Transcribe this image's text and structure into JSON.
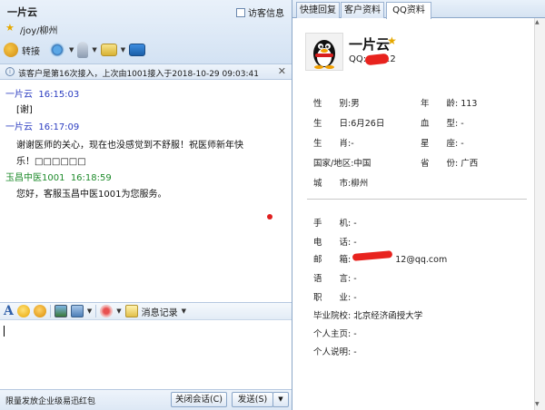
{
  "chat_window": {
    "contact_name": "一片云",
    "visitor_info_label": "访客信息",
    "location": "/joy/柳州",
    "toolbar": {
      "transfer_label": "转接"
    },
    "notice": "该客户是第16次接入，上次由1001接入于2018-10-29 09:03:41",
    "messages": [
      {
        "sender": "一片云",
        "time": "16:15:03",
        "text": "[谢]",
        "color": "#2b3cc0"
      },
      {
        "sender": "一片云",
        "time": "16:17:09",
        "text": "谢谢医师的关心，现在也没感觉到不舒服！祝医师新年快",
        "text2": "乐！□□□□□□",
        "color": "#2b3cc0"
      },
      {
        "sender": "玉昌中医1001",
        "time": "16:18:59",
        "text": "您好，客服玉昌中医1001为您服务。",
        "color": "#1e8b2b"
      }
    ],
    "input_toolbar": {
      "history_label": "消息记录"
    },
    "promo_link": "限量发放企业级易迅红包",
    "close_button": "关闭会话(C)",
    "send_button": "发送(S)"
  },
  "profile_panel": {
    "tabs": [
      {
        "label": "快捷回复",
        "active": false
      },
      {
        "label": "客户资料",
        "active": false
      },
      {
        "label": "QQ资料",
        "active": true
      }
    ],
    "name": "一片云",
    "qq_label": "QQ:",
    "qq_value": "12",
    "fields": {
      "gender": {
        "label": "性　　别:",
        "value": "男"
      },
      "age": {
        "label": "年　　龄:",
        "value": "113"
      },
      "birthday": {
        "label": "生　　日:",
        "value": "6月26日"
      },
      "blood_type": {
        "label": "血　　型:",
        "value": "-"
      },
      "zodiac": {
        "label": "生　　肖:",
        "value": "-"
      },
      "constellation": {
        "label": "星　　座:",
        "value": "-"
      },
      "country": {
        "label": "国家/地区:",
        "value": "中国"
      },
      "province": {
        "label": "省　　份:",
        "value": "广西"
      },
      "city": {
        "label": "城　　市:",
        "value": "柳州"
      },
      "mobile": {
        "label": "手　　机:",
        "value": "-"
      },
      "phone": {
        "label": "电　　话:",
        "value": "-"
      },
      "email": {
        "label": "邮　　箱:",
        "value": "12@qq.com"
      },
      "language": {
        "label": "语　　言:",
        "value": "-"
      },
      "occupation": {
        "label": "职　　业:",
        "value": "-"
      },
      "school": {
        "label": "毕业院校:",
        "value": "北京经济函授大学"
      },
      "homepage": {
        "label": "个人主页:",
        "value": "-"
      },
      "description": {
        "label": "个人说明:",
        "value": "-"
      }
    }
  },
  "colors": {
    "accent": "#2b3cc0",
    "agent": "#1e8b2b",
    "redaction": "#e8231e"
  }
}
